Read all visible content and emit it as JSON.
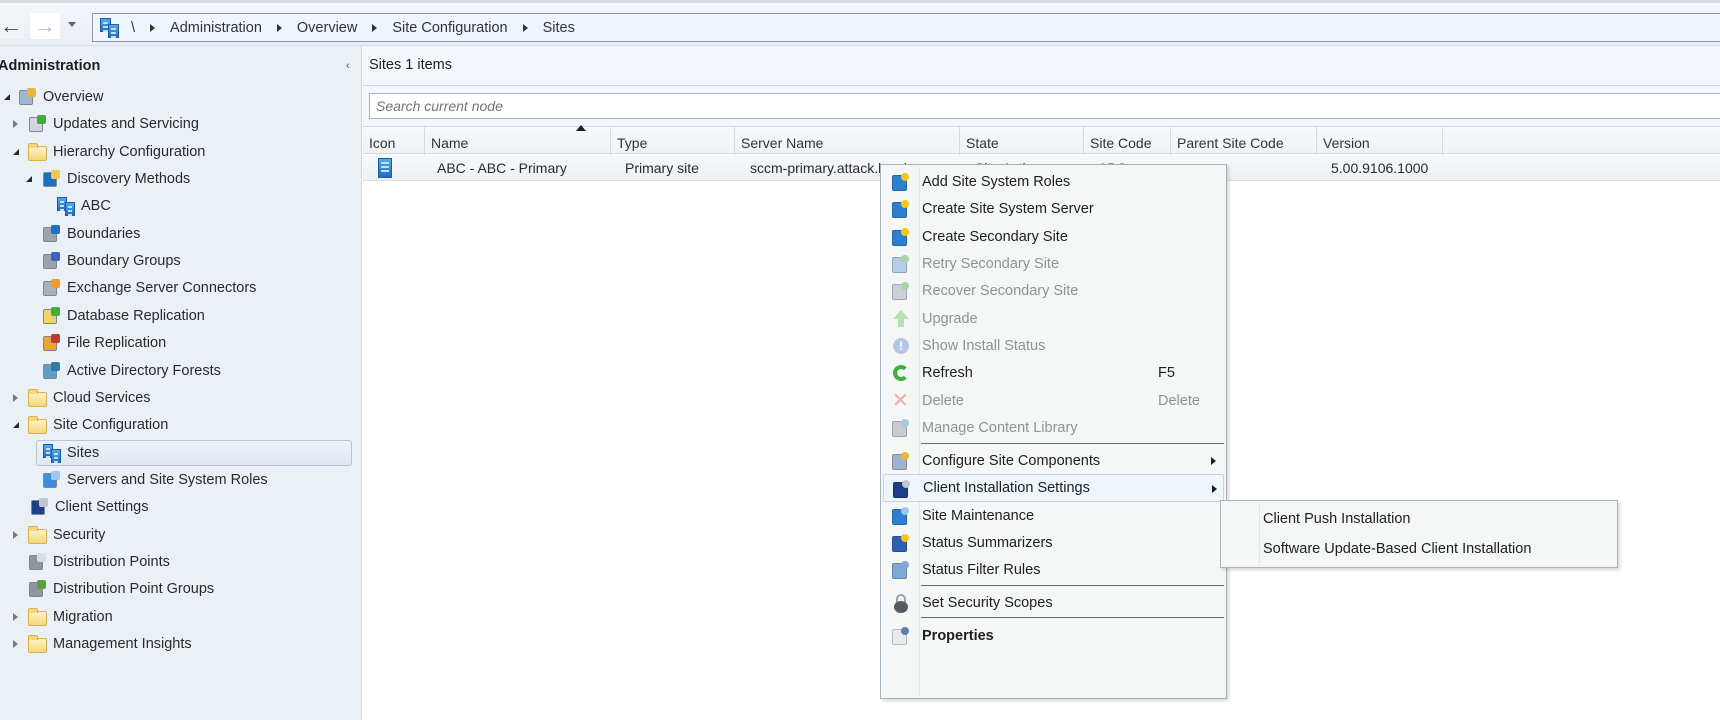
{
  "nav": {
    "back_label": "Back",
    "forward_label": "Forward",
    "breadcrumb": [
      "\\",
      "Administration",
      "Overview",
      "Site Configuration",
      "Sites"
    ]
  },
  "sidebar": {
    "title": "Administration",
    "collapse_glyph": "‹",
    "items": [
      {
        "label": "Overview",
        "icon": "overview-icon",
        "expander": "expanded"
      },
      {
        "label": "Updates and Servicing",
        "icon": "updates-icon",
        "expander": "collapsed"
      },
      {
        "label": "Hierarchy Configuration",
        "icon": "folder-icon",
        "expander": "expanded"
      },
      {
        "label": "Discovery Methods",
        "icon": "discovery-methods-icon",
        "expander": "expanded"
      },
      {
        "label": "ABC",
        "icon": "site-icon",
        "expander": "none"
      },
      {
        "label": "Boundaries",
        "icon": "boundaries-icon",
        "expander": "none"
      },
      {
        "label": "Boundary Groups",
        "icon": "boundary-groups-icon",
        "expander": "none"
      },
      {
        "label": "Exchange Server Connectors",
        "icon": "exchange-connector-icon",
        "expander": "none"
      },
      {
        "label": "Database Replication",
        "icon": "database-replication-icon",
        "expander": "none"
      },
      {
        "label": "File Replication",
        "icon": "file-replication-icon",
        "expander": "none"
      },
      {
        "label": "Active Directory Forests",
        "icon": "ad-forest-icon",
        "expander": "none"
      },
      {
        "label": "Cloud Services",
        "icon": "folder-icon",
        "expander": "collapsed"
      },
      {
        "label": "Site Configuration",
        "icon": "folder-icon",
        "expander": "expanded"
      },
      {
        "label": "Sites",
        "icon": "site-icon",
        "expander": "none",
        "selected": true
      },
      {
        "label": "Servers and Site System Roles",
        "icon": "server-roles-icon",
        "expander": "none"
      },
      {
        "label": "Client Settings",
        "icon": "client-settings-icon",
        "expander": "none"
      },
      {
        "label": "Security",
        "icon": "folder-icon",
        "expander": "collapsed"
      },
      {
        "label": "Distribution Points",
        "icon": "distribution-points-icon",
        "expander": "none"
      },
      {
        "label": "Distribution Point Groups",
        "icon": "distribution-point-groups-icon",
        "expander": "none"
      },
      {
        "label": "Migration",
        "icon": "folder-icon",
        "expander": "collapsed"
      },
      {
        "label": "Management Insights",
        "icon": "folder-icon",
        "expander": "collapsed"
      }
    ]
  },
  "main": {
    "title": "Sites 1 items",
    "search_placeholder": "Search current node",
    "columns": [
      "Icon",
      "Name",
      "Type",
      "Server Name",
      "State",
      "Site Code",
      "Parent Site Code",
      "Version"
    ],
    "sorted_column": "Name",
    "rows": [
      {
        "icon": "site-icon",
        "name": "ABC - ABC - Primary",
        "type": "Primary site",
        "server_name": "sccm-primary.attack.local",
        "state": "Site Active",
        "site_code": "ABC",
        "parent_site_code": "",
        "version": "5.00.9106.1000"
      }
    ]
  },
  "context_menu": {
    "items": [
      {
        "label": "Add Site System Roles",
        "icon": "add-site-system-roles-icon",
        "enabled": true
      },
      {
        "label": "Create Site System Server",
        "icon": "create-site-system-server-icon",
        "enabled": true
      },
      {
        "label": "Create Secondary Site",
        "icon": "create-secondary-site-icon",
        "enabled": true
      },
      {
        "label": "Retry Secondary Site",
        "icon": "retry-secondary-site-icon",
        "enabled": false
      },
      {
        "label": "Recover Secondary Site",
        "icon": "recover-secondary-site-icon",
        "enabled": false
      },
      {
        "label": "Upgrade",
        "icon": "upgrade-icon",
        "enabled": false
      },
      {
        "label": "Show Install Status",
        "icon": "info-icon",
        "enabled": false
      },
      {
        "label": "Refresh",
        "icon": "refresh-icon",
        "enabled": true,
        "shortcut": "F5"
      },
      {
        "label": "Delete",
        "icon": "delete-icon",
        "enabled": false,
        "shortcut": "Delete"
      },
      {
        "label": "Manage Content Library",
        "icon": "content-library-icon",
        "enabled": false
      },
      {
        "label": "Configure Site Components",
        "icon": "configure-components-icon",
        "enabled": true,
        "submenu": true
      },
      {
        "label": "Client Installation Settings",
        "icon": "client-installation-icon",
        "enabled": true,
        "submenu": true,
        "highlighted": true
      },
      {
        "label": "Site Maintenance",
        "icon": "site-maintenance-icon",
        "enabled": true
      },
      {
        "label": "Status Summarizers",
        "icon": "status-summarizers-icon",
        "enabled": true
      },
      {
        "label": "Status Filter Rules",
        "icon": "status-filter-rules-icon",
        "enabled": true
      },
      {
        "label": "Set Security Scopes",
        "icon": "security-scopes-icon",
        "enabled": true
      },
      {
        "label": "Properties",
        "icon": "properties-icon",
        "enabled": true,
        "bold": true
      }
    ]
  },
  "submenu": {
    "items": [
      {
        "label": "Client Push Installation"
      },
      {
        "label": "Software Update-Based Client Installation"
      }
    ]
  },
  "colors": {
    "sidebar_bg": "#ebf0f7",
    "address_bar_bg": "#eef5fd",
    "menu_bg": "#f4f7f5",
    "disabled_text": "#8d9298",
    "accent_blue": "#1d6fc0"
  }
}
